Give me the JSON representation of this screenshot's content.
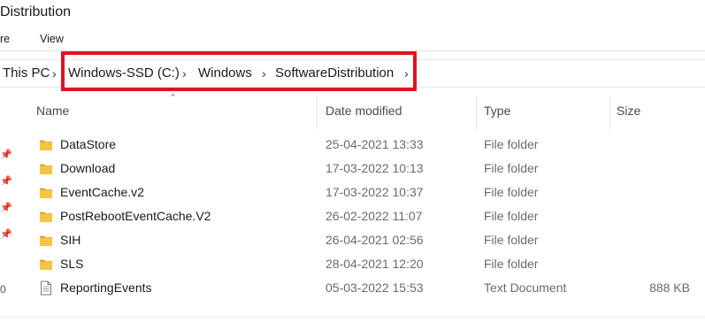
{
  "window": {
    "title": "Distribution"
  },
  "menu": {
    "item_1": "re",
    "item_2": "View"
  },
  "addressbar": {
    "segments": [
      "This PC",
      "Windows-SSD (C:)",
      "Windows",
      "SoftwareDistribution"
    ],
    "highlight_color": "#e0141e"
  },
  "columns": {
    "name": "Name",
    "date": "Date modified",
    "type": "Type",
    "size": "Size"
  },
  "rows": [
    {
      "name": "DataStore",
      "date": "25-04-2021 13:33",
      "type": "File folder",
      "size": "",
      "icon": "folder-icon"
    },
    {
      "name": "Download",
      "date": "17-03-2022 10:13",
      "type": "File folder",
      "size": "",
      "icon": "folder-icon"
    },
    {
      "name": "EventCache.v2",
      "date": "17-03-2022 10:37",
      "type": "File folder",
      "size": "",
      "icon": "folder-icon"
    },
    {
      "name": "PostRebootEventCache.V2",
      "date": "26-02-2022 11:07",
      "type": "File folder",
      "size": "",
      "icon": "folder-icon"
    },
    {
      "name": "SIH",
      "date": "26-04-2021 02:56",
      "type": "File folder",
      "size": "",
      "icon": "folder-icon"
    },
    {
      "name": "SLS",
      "date": "28-04-2021 12:20",
      "type": "File folder",
      "size": "",
      "icon": "folder-icon"
    },
    {
      "name": "ReportingEvents",
      "date": "05-03-2022 15:53",
      "type": "Text Document",
      "size": "888 KB",
      "icon": "text-document-icon"
    }
  ],
  "sidebar": {
    "edge_label": "0"
  },
  "colors": {
    "folder": "#f5c542",
    "folder_dark": "#e0a82e",
    "text_secondary": "#6b6b6b"
  }
}
